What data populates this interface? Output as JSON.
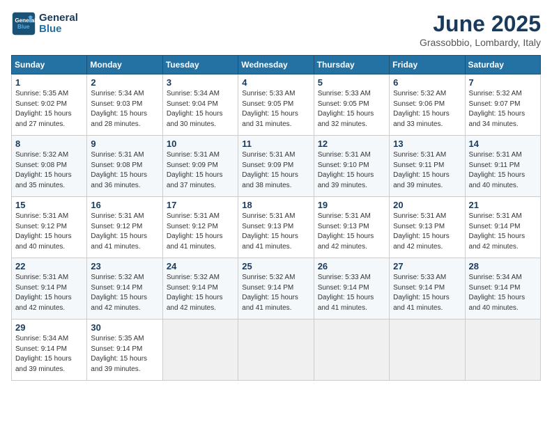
{
  "header": {
    "logo_line1": "General",
    "logo_line2": "Blue",
    "title": "June 2025",
    "subtitle": "Grassobbio, Lombardy, Italy"
  },
  "calendar": {
    "days_of_week": [
      "Sunday",
      "Monday",
      "Tuesday",
      "Wednesday",
      "Thursday",
      "Friday",
      "Saturday"
    ],
    "weeks": [
      [
        null,
        {
          "day": 2,
          "rise": "5:34 AM",
          "set": "9:03 PM",
          "daylight": "15 hours and 28 minutes."
        },
        {
          "day": 3,
          "rise": "5:34 AM",
          "set": "9:04 PM",
          "daylight": "15 hours and 30 minutes."
        },
        {
          "day": 4,
          "rise": "5:33 AM",
          "set": "9:05 PM",
          "daylight": "15 hours and 31 minutes."
        },
        {
          "day": 5,
          "rise": "5:33 AM",
          "set": "9:05 PM",
          "daylight": "15 hours and 32 minutes."
        },
        {
          "day": 6,
          "rise": "5:32 AM",
          "set": "9:06 PM",
          "daylight": "15 hours and 33 minutes."
        },
        {
          "day": 7,
          "rise": "5:32 AM",
          "set": "9:07 PM",
          "daylight": "15 hours and 34 minutes."
        }
      ],
      [
        {
          "day": 1,
          "rise": "5:35 AM",
          "set": "9:02 PM",
          "daylight": "15 hours and 27 minutes."
        },
        {
          "day": 8,
          "rise": "5:32 AM",
          "set": "9:08 PM",
          "daylight": "15 hours and 35 minutes."
        },
        {
          "day": 9,
          "rise": "5:31 AM",
          "set": "9:08 PM",
          "daylight": "15 hours and 36 minutes."
        },
        {
          "day": 10,
          "rise": "5:31 AM",
          "set": "9:09 PM",
          "daylight": "15 hours and 37 minutes."
        },
        {
          "day": 11,
          "rise": "5:31 AM",
          "set": "9:09 PM",
          "daylight": "15 hours and 38 minutes."
        },
        {
          "day": 12,
          "rise": "5:31 AM",
          "set": "9:10 PM",
          "daylight": "15 hours and 39 minutes."
        },
        {
          "day": 13,
          "rise": "5:31 AM",
          "set": "9:11 PM",
          "daylight": "15 hours and 39 minutes."
        },
        {
          "day": 14,
          "rise": "5:31 AM",
          "set": "9:11 PM",
          "daylight": "15 hours and 40 minutes."
        }
      ],
      [
        {
          "day": 15,
          "rise": "5:31 AM",
          "set": "9:12 PM",
          "daylight": "15 hours and 40 minutes."
        },
        {
          "day": 16,
          "rise": "5:31 AM",
          "set": "9:12 PM",
          "daylight": "15 hours and 41 minutes."
        },
        {
          "day": 17,
          "rise": "5:31 AM",
          "set": "9:12 PM",
          "daylight": "15 hours and 41 minutes."
        },
        {
          "day": 18,
          "rise": "5:31 AM",
          "set": "9:13 PM",
          "daylight": "15 hours and 41 minutes."
        },
        {
          "day": 19,
          "rise": "5:31 AM",
          "set": "9:13 PM",
          "daylight": "15 hours and 42 minutes."
        },
        {
          "day": 20,
          "rise": "5:31 AM",
          "set": "9:13 PM",
          "daylight": "15 hours and 42 minutes."
        },
        {
          "day": 21,
          "rise": "5:31 AM",
          "set": "9:14 PM",
          "daylight": "15 hours and 42 minutes."
        }
      ],
      [
        {
          "day": 22,
          "rise": "5:31 AM",
          "set": "9:14 PM",
          "daylight": "15 hours and 42 minutes."
        },
        {
          "day": 23,
          "rise": "5:32 AM",
          "set": "9:14 PM",
          "daylight": "15 hours and 42 minutes."
        },
        {
          "day": 24,
          "rise": "5:32 AM",
          "set": "9:14 PM",
          "daylight": "15 hours and 42 minutes."
        },
        {
          "day": 25,
          "rise": "5:32 AM",
          "set": "9:14 PM",
          "daylight": "15 hours and 41 minutes."
        },
        {
          "day": 26,
          "rise": "5:33 AM",
          "set": "9:14 PM",
          "daylight": "15 hours and 41 minutes."
        },
        {
          "day": 27,
          "rise": "5:33 AM",
          "set": "9:14 PM",
          "daylight": "15 hours and 41 minutes."
        },
        {
          "day": 28,
          "rise": "5:34 AM",
          "set": "9:14 PM",
          "daylight": "15 hours and 40 minutes."
        }
      ],
      [
        {
          "day": 29,
          "rise": "5:34 AM",
          "set": "9:14 PM",
          "daylight": "15 hours and 39 minutes."
        },
        {
          "day": 30,
          "rise": "5:35 AM",
          "set": "9:14 PM",
          "daylight": "15 hours and 39 minutes."
        },
        null,
        null,
        null,
        null,
        null
      ]
    ]
  }
}
